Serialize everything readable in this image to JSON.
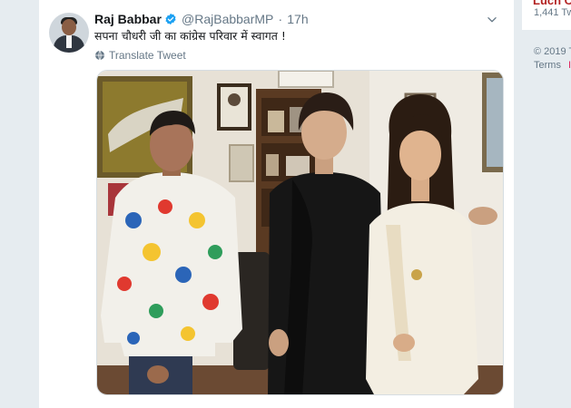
{
  "tweet": {
    "display_name": "Raj Babbar",
    "handle": "@RajBabbarMP",
    "separator": "·",
    "time": "17h",
    "text": "सपना चौधरी जी का कांग्रेस परिवार में स्वागत !",
    "translate_label": "Translate Tweet",
    "icons": {
      "verified": "verified-badge-icon",
      "more": "chevron-down-icon",
      "translate": "globe-icon"
    },
    "colors": {
      "verified": "#1da1f2",
      "text": "#14171a",
      "secondary": "#657786"
    }
  },
  "sidebar": {
    "trend_title": "Lucn C",
    "trend_count": "1,441 Tw",
    "copyright": "© 2019 T",
    "terms_label": "Terms",
    "terms_extra": "I"
  }
}
